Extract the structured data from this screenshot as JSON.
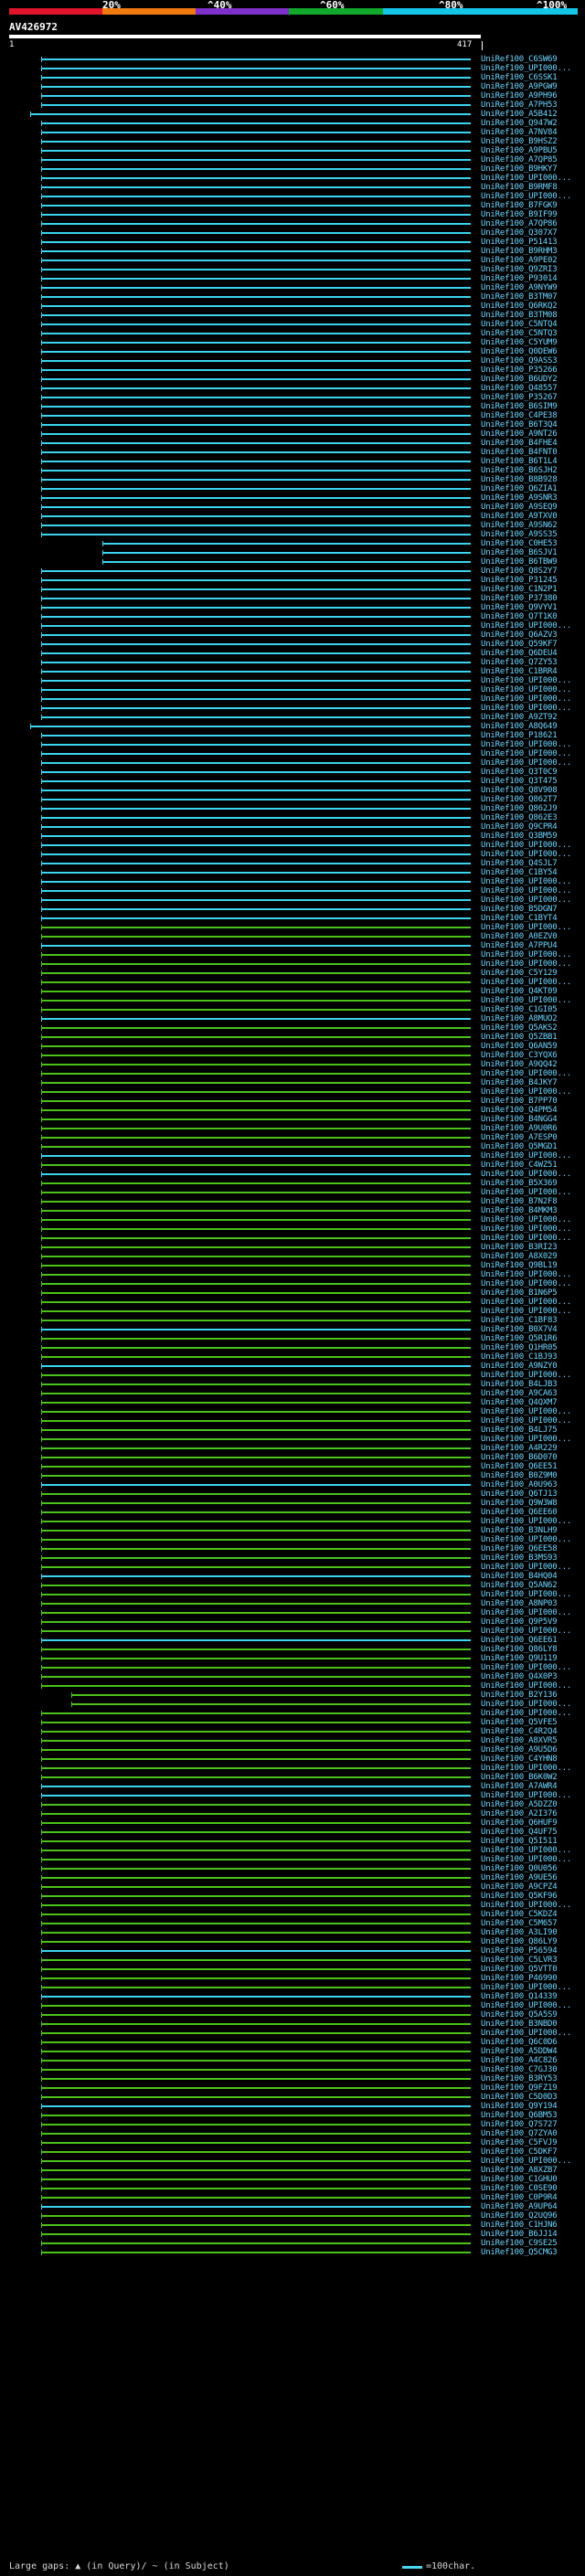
{
  "header": {
    "scale_labels": [
      "20%",
      "^40%",
      "^60%",
      "^80%",
      "^100%"
    ],
    "scale_colors": [
      "#e0142a",
      "#f07a10",
      "#7e30c8",
      "#11a82b",
      "#14c6e6"
    ],
    "query_name": "AV426972",
    "start_pos": "1",
    "end_pos": "417"
  },
  "colors": {
    "cyan": "#3cd4ee",
    "green": "#4cc21a",
    "label": "#6fd6ff"
  },
  "hits": [
    "UniRef100_C6SW69",
    "UniRef100_UPI000...",
    "UniRef100_C6SSK1",
    "UniRef100_A9PGW9",
    "UniRef100_A9PH96",
    "UniRef100_A7PH53",
    "UniRef100_A5B412",
    "UniRef100_Q947W2",
    "UniRef100_A7NV84",
    "UniRef100_B9HSZ2",
    "UniRef100_A9PBU5",
    "UniRef100_A7QP85",
    "UniRef100_B9HKY7",
    "UniRef100_UPI000...",
    "UniRef100_B9RMF8",
    "UniRef100_UPI000...",
    "UniRef100_B7FGK9",
    "UniRef100_B9IF99",
    "UniRef100_A7QP86",
    "UniRef100_Q307X7",
    "UniRef100_P51413",
    "UniRef100_B9RHM3",
    "UniRef100_A9PE02",
    "UniRef100_Q9ZRI3",
    "UniRef100_P93014",
    "UniRef100_A9NYW9",
    "UniRef100_B3TM07",
    "UniRef100_Q6RKQ2",
    "UniRef100_B3TM08",
    "UniRef100_C5NTQ4",
    "UniRef100_C5NTQ3",
    "UniRef100_C5YUM9",
    "UniRef100_Q0DEW6",
    "UniRef100_Q9ASS3",
    "UniRef100_P35266",
    "UniRef100_B6UDY2",
    "UniRef100_Q48557",
    "UniRef100_P35267",
    "UniRef100_B6SIM9",
    "UniRef100_C4PE38",
    "UniRef100_B6T3Q4",
    "UniRef100_A9NT26",
    "UniRef100_B4FHE4",
    "UniRef100_B4FNT0",
    "UniRef100_B6T1L4",
    "UniRef100_B6SJH2",
    "UniRef100_B8B928",
    "UniRef100_Q6ZIA1",
    "UniRef100_A9SNR3",
    "UniRef100_A9SEQ9",
    "UniRef100_A9TXV0",
    "UniRef100_A9SN62",
    "UniRef100_A9SS35",
    "UniRef100_C0HE53",
    "UniRef100_B6SJV1",
    "UniRef100_B6TBW9",
    "UniRef100_Q8S2Y7",
    "UniRef100_P31245",
    "UniRef100_C1N2P1",
    "UniRef100_P37380",
    "UniRef100_Q9VYV1",
    "UniRef100_Q7T1K0",
    "UniRef100_UPI000...",
    "UniRef100_Q6AZV3",
    "UniRef100_Q59KF7",
    "UniRef100_Q6DEU4",
    "UniRef100_Q7ZY53",
    "UniRef100_C1BRR4",
    "UniRef100_UPI000...",
    "UniRef100_UPI000...",
    "UniRef100_UPI000...",
    "UniRef100_UPI000...",
    "UniRef100_A9ZT92",
    "UniRef100_A8Q649",
    "UniRef100_P18621",
    "UniRef100_UPI000...",
    "UniRef100_UPI000...",
    "UniRef100_UPI000...",
    "UniRef100_Q3T0C9",
    "UniRef100_Q3T475",
    "UniRef100_Q8V908",
    "UniRef100_Q862T7",
    "UniRef100_Q862J9",
    "UniRef100_Q862E3",
    "UniRef100_Q9CPR4",
    "UniRef100_Q3BM59",
    "UniRef100_UPI000...",
    "UniRef100_UPI000...",
    "UniRef100_Q4SJL7",
    "UniRef100_C1BY54",
    "UniRef100_UPI000...",
    "UniRef100_UPI000...",
    "UniRef100_UPI000...",
    "UniRef100_B5DGN7",
    "UniRef100_C1BYT4",
    "UniRef100_UPI000...",
    "UniRef100_A0EZV0",
    "UniRef100_A7PPU4",
    "UniRef100_UPI000...",
    "UniRef100_UPI000...",
    "UniRef100_C5Y129",
    "UniRef100_UPI000...",
    "UniRef100_Q4KT09",
    "UniRef100_UPI000...",
    "UniRef100_C1GI05",
    "UniRef100_A8MUO2",
    "UniRef100_Q5AKS2",
    "UniRef100_Q5ZBB1",
    "UniRef100_Q6AN59",
    "UniRef100_C3YQX6",
    "UniRef100_A9QQ42",
    "UniRef100_UPI000...",
    "UniRef100_B4JKY7",
    "UniRef100_UPI000...",
    "UniRef100_B7PP70",
    "UniRef100_Q4PM54",
    "UniRef100_B4NGG4",
    "UniRef100_A9U0R6",
    "UniRef100_A7ESP0",
    "UniRef100_Q5MGD1",
    "UniRef100_UPI000...",
    "UniRef100_C4WZ51",
    "UniRef100_UPI000...",
    "UniRef100_B5X369",
    "UniRef100_UPI000...",
    "UniRef100_B7N2F8",
    "UniRef100_B4MKM3",
    "UniRef100_UPI000...",
    "UniRef100_UPI000...",
    "UniRef100_UPI000...",
    "UniRef100_B3RI23",
    "UniRef100_A8X029",
    "UniRef100_Q9BL19",
    "UniRef100_UPI000...",
    "UniRef100_UPI000...",
    "UniRef100_B1N6P5",
    "UniRef100_UPI000...",
    "UniRef100_UPI000...",
    "UniRef100_C1BF83",
    "UniRef100_B0X7V4",
    "UniRef100_Q5R1R6",
    "UniRef100_Q1HR05",
    "UniRef100_C1BJ93",
    "UniRef100_A9NZY0",
    "UniRef100_UPI000...",
    "UniRef100_B4LJB3",
    "UniRef100_A9CA63",
    "UniRef100_Q4QXM7",
    "UniRef100_UPI000...",
    "UniRef100_UPI000...",
    "UniRef100_B4LJ75",
    "UniRef100_UPI000...",
    "UniRef100_A4R229",
    "UniRef100_B6D070",
    "UniRef100_Q6EE51",
    "UniRef100_B0Z9M0",
    "UniRef100_A0U963",
    "UniRef100_Q6TJ13",
    "UniRef100_Q9W3W8",
    "UniRef100_Q6EE60",
    "UniRef100_UPI000...",
    "UniRef100_B3NLH9",
    "UniRef100_UPI000...",
    "UniRef100_Q6EE58",
    "UniRef100_B3MS93",
    "UniRef100_UPI000...",
    "UniRef100_B4HQ04",
    "UniRef100_Q5AN62",
    "UniRef100_UPI000...",
    "UniRef100_A8NP03",
    "UniRef100_UPI000...",
    "UniRef100_Q9P5V9",
    "UniRef100_UPI000...",
    "UniRef100_Q6EE61",
    "UniRef100_Q86LY8",
    "UniRef100_Q9U119",
    "UniRef100_UPI000...",
    "UniRef100_Q4X0P3",
    "UniRef100_UPI000...",
    "UniRef100_B2Y136",
    "UniRef100_UPI000...",
    "UniRef100_UPI000...",
    "UniRef100_Q5VFE5",
    "UniRef100_C4R2Q4",
    "UniRef100_A8XVR5",
    "UniRef100_A9U5D6",
    "UniRef100_C4YHN8",
    "UniRef100_UPI000...",
    "UniRef100_B6K0W2",
    "UniRef100_A7AWR4",
    "UniRef100_UPI000...",
    "UniRef100_A5DZZ0",
    "UniRef100_A2I376",
    "UniRef100_Q6HUF9",
    "UniRef100_Q4UF75",
    "UniRef100_Q5I511",
    "UniRef100_UPI000...",
    "UniRef100_UPI000...",
    "UniRef100_Q0U056",
    "UniRef100_A9UE56",
    "UniRef100_A9CPZ4",
    "UniRef100_Q5KF96",
    "UniRef100_UPI000...",
    "UniRef100_C5KDZ4",
    "UniRef100_C5M657",
    "UniRef100_A3LI90",
    "UniRef100_Q86LY9",
    "UniRef100_P56594",
    "UniRef100_C5LVR3",
    "UniRef100_Q5VTT0",
    "UniRef100_P46990",
    "UniRef100_UPI000...",
    "UniRef100_Q14339",
    "UniRef100_UPI000...",
    "UniRef100_Q5A5S9",
    "UniRef100_B3NBD0",
    "UniRef100_UPI000...",
    "UniRef100_Q6C0D6",
    "UniRef100_A5DDW4",
    "UniRef100_A4C826",
    "UniRef100_C7GJ30",
    "UniRef100_B3RY53",
    "UniRef100_Q9FZ19",
    "UniRef100_C5D0D3",
    "UniRef100_Q9Y194",
    "UniRef100_Q6BM53",
    "UniRef100_Q7S727",
    "UniRef100_Q7ZYA0",
    "UniRef100_C5FVJ9",
    "UniRef100_C5DKF7",
    "UniRef100_UPI000...",
    "UniRef100_A8XZB7",
    "UniRef100_C1GHU0",
    "UniRef100_C0SE90",
    "UniRef100_C0P9R4",
    "UniRef100_A9UP64",
    "UniRef100_Q2UQ96",
    "UniRef100_C1HJN6",
    "UniRef100_B6JJ14",
    "UniRef100_C9SE25",
    "UniRef100_Q5CMG3"
  ],
  "legend": {
    "text": "Large gaps: ▲ (in Query)/ ~ (in Subject)",
    "scale_text": "=100char."
  }
}
